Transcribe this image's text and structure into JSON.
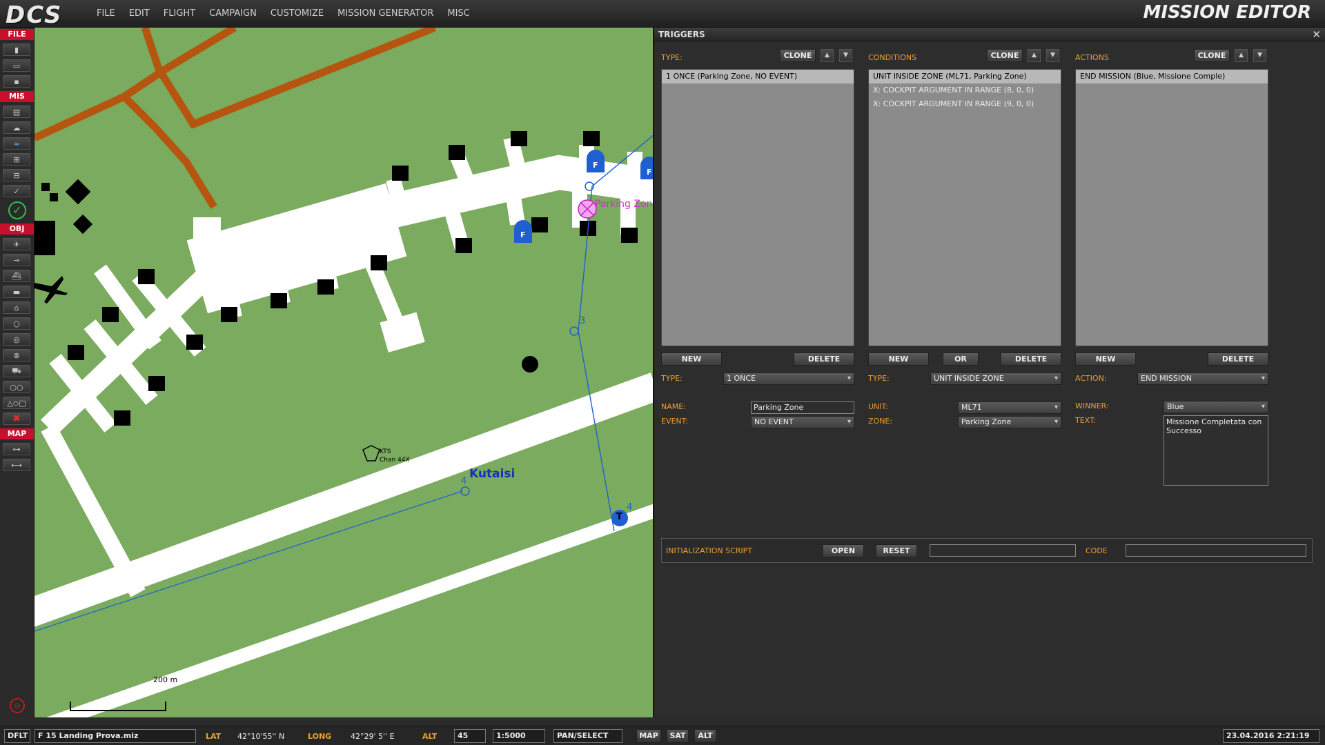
{
  "app": {
    "logo": "DCS",
    "title": "MISSION EDITOR"
  },
  "menu": [
    "FILE",
    "EDIT",
    "FLIGHT",
    "CAMPAIGN",
    "CUSTOMIZE",
    "MISSION GENERATOR",
    "MISC"
  ],
  "toolbar": {
    "sections": [
      "FILE",
      "MIS",
      "OBJ",
      "MAP"
    ]
  },
  "map": {
    "airfield_name": "Kutaisi",
    "beacon_label_1": "KTS",
    "beacon_label_2": "Chan 44X",
    "zone_label": "Parking Zon",
    "waypoint_3": "3",
    "waypoint_4a": "4",
    "waypoint_4b": "4",
    "takeoff_marker": "T",
    "flag_label": "F",
    "scale_label": "200 m"
  },
  "triggers": {
    "header": "TRIGGERS",
    "close_icon": "close-icon",
    "type_col": {
      "label": "TYPE:",
      "clone": "CLONE",
      "items": [
        "1 ONCE (Parking Zone, NO EVENT)"
      ],
      "new": "NEW",
      "delete": "DELETE",
      "type_label": "TYPE:",
      "type_value": "1 ONCE",
      "name_label": "NAME:",
      "name_value": "Parking Zone",
      "event_label": "EVENT:",
      "event_value": "NO EVENT"
    },
    "cond_col": {
      "label": "CONDITIONS",
      "clone": "CLONE",
      "items": [
        "UNIT INSIDE ZONE (ML71, Parking Zone)",
        "X: COCKPIT ARGUMENT IN RANGE (8, 0, 0)",
        "X: COCKPIT ARGUMENT IN RANGE (9, 0, 0)"
      ],
      "new": "NEW",
      "or": "OR",
      "delete": "DELETE",
      "type_label": "TYPE:",
      "type_value": "UNIT INSIDE ZONE",
      "unit_label": "UNIT:",
      "unit_value": "ML71",
      "zone_label": "ZONE:",
      "zone_value": "Parking Zone"
    },
    "act_col": {
      "label": "ACTIONS",
      "clone": "CLONE",
      "items": [
        "END MISSION (Blue, Missione Comple)"
      ],
      "new": "NEW",
      "delete": "DELETE",
      "action_label": "ACTION:",
      "action_value": "END MISSION",
      "winner_label": "WINNER:",
      "winner_value": "Blue",
      "text_label": "TEXT:",
      "text_value": "Missione Completata con Successo"
    },
    "init": {
      "label": "INITIALIZATION SCRIPT",
      "open": "OPEN",
      "reset": "RESET",
      "code_label": "CODE"
    }
  },
  "status": {
    "mode": "DFLT",
    "file": "F 15 Landing Prova.miz",
    "lat_label": "LAT",
    "lat_value": "42°10'55'' N",
    "long_label": "LONG",
    "long_value": "42°29' 5'' E",
    "alt_label": "ALT",
    "alt_value": "45",
    "scale": "1:5000",
    "tool": "PAN/SELECT",
    "map_btn": "MAP",
    "sat_btn": "SAT",
    "alt_btn": "ALT",
    "datetime": "23.04.2016 2:21:19"
  }
}
